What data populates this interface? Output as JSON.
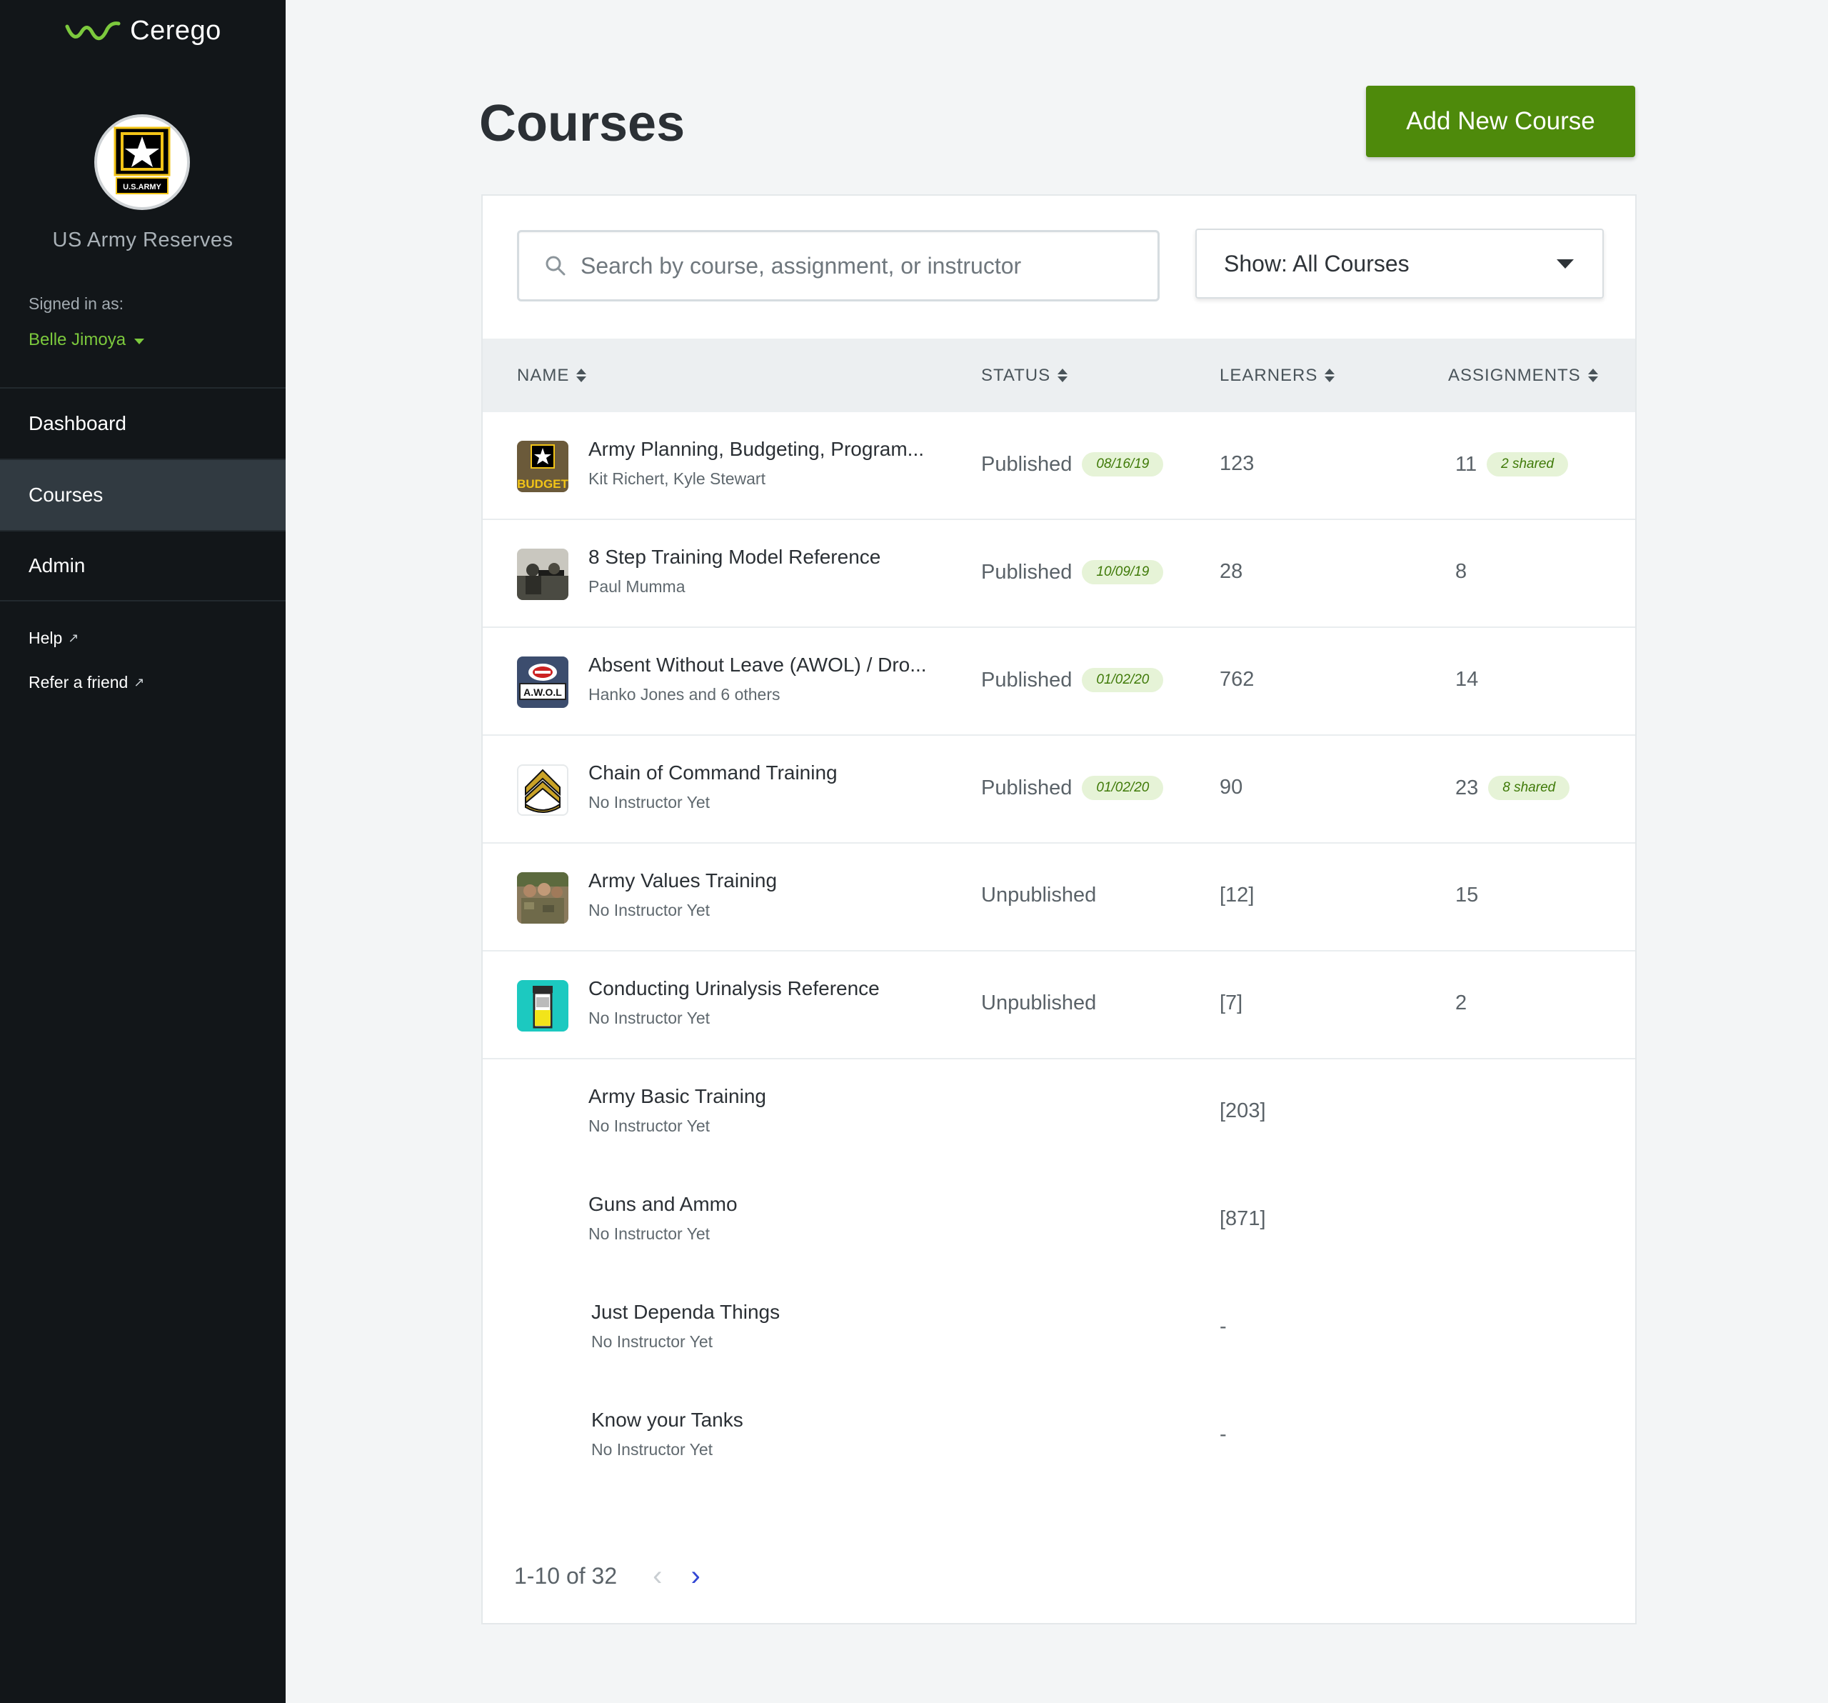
{
  "app": {
    "brand": "Cerego",
    "org_name": "US Army Reserves",
    "org_logo_text": "U.S.ARMY"
  },
  "sidebar": {
    "signed_in_label": "Signed in as:",
    "user_name": "Belle Jimoya",
    "nav": [
      {
        "label": "Dashboard"
      },
      {
        "label": "Courses",
        "active": true
      },
      {
        "label": "Admin"
      }
    ],
    "links": [
      {
        "label": "Help"
      },
      {
        "label": "Refer a friend"
      }
    ]
  },
  "page": {
    "title": "Courses",
    "add_button": "Add New Course"
  },
  "search": {
    "placeholder": "Search by course, assignment, or instructor",
    "value": ""
  },
  "filter": {
    "label": "Show: All Courses"
  },
  "table": {
    "headers": {
      "name": "NAME",
      "status": "STATUS",
      "learners": "LEARNERS",
      "assignments": "ASSIGNMENTS"
    },
    "rows": [
      {
        "title": "Army Planning, Budgeting, Program...",
        "instructors": "Kit Richert, Kyle Stewart",
        "status": "Published",
        "date": "08/16/19",
        "learners": "123",
        "assignments": "11",
        "shared": "2 shared"
      },
      {
        "title": "8 Step Training Model Reference",
        "instructors": "Paul Mumma",
        "status": "Published",
        "date": "10/09/19",
        "learners": "28",
        "assignments": "8",
        "shared": ""
      },
      {
        "title": "Absent Without Leave (AWOL) / Dro...",
        "instructors": "Hanko Jones and 6 others",
        "status": "Published",
        "date": "01/02/20",
        "learners": "762",
        "assignments": "14",
        "shared": ""
      },
      {
        "title": "Chain of Command Training",
        "instructors": "No Instructor Yet",
        "status": "Published",
        "date": "01/02/20",
        "learners": "90",
        "assignments": "23",
        "shared": "8 shared"
      },
      {
        "title": "Army Values Training",
        "instructors": "No Instructor Yet",
        "status": "Unpublished",
        "date": "",
        "learners": "[12]",
        "assignments": "15",
        "shared": ""
      },
      {
        "title": "Conducting Urinalysis Reference",
        "instructors": "No Instructor Yet",
        "status": "Unpublished",
        "date": "",
        "learners": "[7]",
        "assignments": "2",
        "shared": ""
      },
      {
        "title": "Army Basic Training",
        "instructors": "No Instructor Yet",
        "status": "",
        "date": "",
        "learners": "[203]",
        "assignments": "",
        "shared": ""
      },
      {
        "title": "Guns and Ammo",
        "instructors": "No Instructor Yet",
        "status": "",
        "date": "",
        "learners": "[871]",
        "assignments": "",
        "shared": ""
      },
      {
        "title": "Just Dependa Things",
        "instructors": "No Instructor Yet",
        "status": "",
        "date": "",
        "learners": "-",
        "assignments": "",
        "shared": ""
      },
      {
        "title": "Know your Tanks",
        "instructors": "No Instructor Yet",
        "status": "",
        "date": "",
        "learners": "-",
        "assignments": "",
        "shared": ""
      }
    ],
    "thumbnails": {
      "budget_text": "BUDGET",
      "awol_text": "A.W.O.L"
    }
  },
  "pagination": {
    "range": "1-10 of 32",
    "prev": "‹",
    "next": "›"
  },
  "colors": {
    "accent_green": "#4e8a0b",
    "sidebar_bg": "#121619",
    "link_green": "#7cc93d",
    "pager_blue": "#3347d4"
  }
}
